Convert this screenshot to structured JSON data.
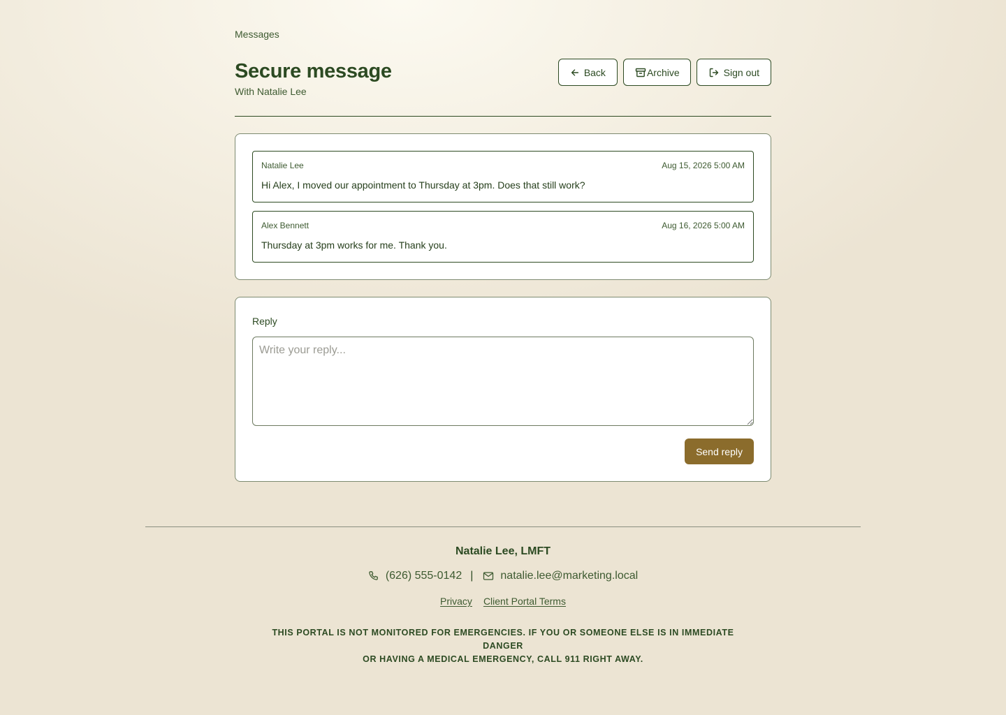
{
  "breadcrumb": "Messages",
  "header": {
    "title": "Secure message",
    "subtitle": "With Natalie Lee",
    "actions": {
      "back": {
        "label": "Back",
        "icon": "arrow-left-icon"
      },
      "archive": {
        "label": "Archive",
        "icon": "archive-box-icon"
      },
      "sign_out": {
        "label": "Sign out",
        "icon": "sign-out-icon"
      }
    }
  },
  "thread": {
    "messages": [
      {
        "sender": "Natalie Lee",
        "timestamp": "Aug 15, 2026 5:00 AM",
        "body": "Hi Alex, I moved our appointment to Thursday at 3pm. Does that still work?"
      },
      {
        "sender": "Alex Bennett",
        "timestamp": "Aug 16, 2026 5:00 AM",
        "body": "Thursday at 3pm works for me. Thank you."
      }
    ]
  },
  "reply": {
    "label": "Reply",
    "placeholder": "Write your reply...",
    "value": "",
    "send_label": "Send reply"
  },
  "footer": {
    "name": "Natalie Lee, LMFT",
    "phone": "(626) 555-0142",
    "separator": "|",
    "email": "natalie.lee@marketing.local",
    "links": [
      "Privacy",
      "Client Portal Terms"
    ],
    "disclaimer_line1": "THIS PORTAL IS NOT MONITORED FOR EMERGENCIES. IF YOU OR SOMEONE ELSE IS IN IMMEDIATE DANGER",
    "disclaimer_line2": "OR HAVING A MEDICAL EMERGENCY, CALL 911 RIGHT AWAY."
  },
  "colors": {
    "primary_text": "#2c4a22",
    "accent_button": "#8b6c2c",
    "border": "#2d4a22",
    "background": "#f5f0e3"
  }
}
